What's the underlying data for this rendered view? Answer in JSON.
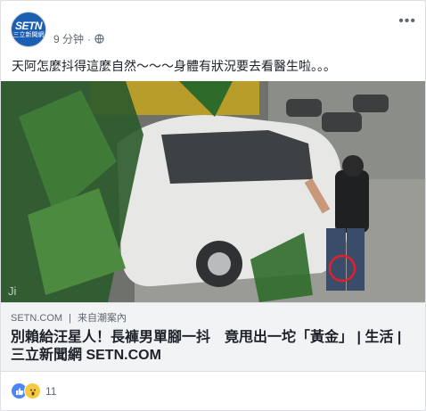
{
  "post": {
    "page_avatar": {
      "line1": "SETN",
      "line2": "三立新聞網"
    },
    "time": "9 分钟",
    "audience_icon": "globe-icon",
    "message": "天阿怎麼抖得這麼自然～～～身體有狀況要去看醫生啦。。。"
  },
  "link_preview": {
    "domain": "SETN.COM",
    "via_prefix": "来自",
    "via_source": "潮案內",
    "title": "別賴給汪星人！長褲男單腳一抖　竟甩出一坨「黃金」 | 生活 | 三立新聞網 SETN.COM"
  },
  "reactions": {
    "icons": [
      "like-icon",
      "wow-icon"
    ],
    "count": "11"
  },
  "colors": {
    "link_bg": "#f2f3f5",
    "brand_blue": "#1b5fb3",
    "highlight_circle": "#e0202a"
  }
}
